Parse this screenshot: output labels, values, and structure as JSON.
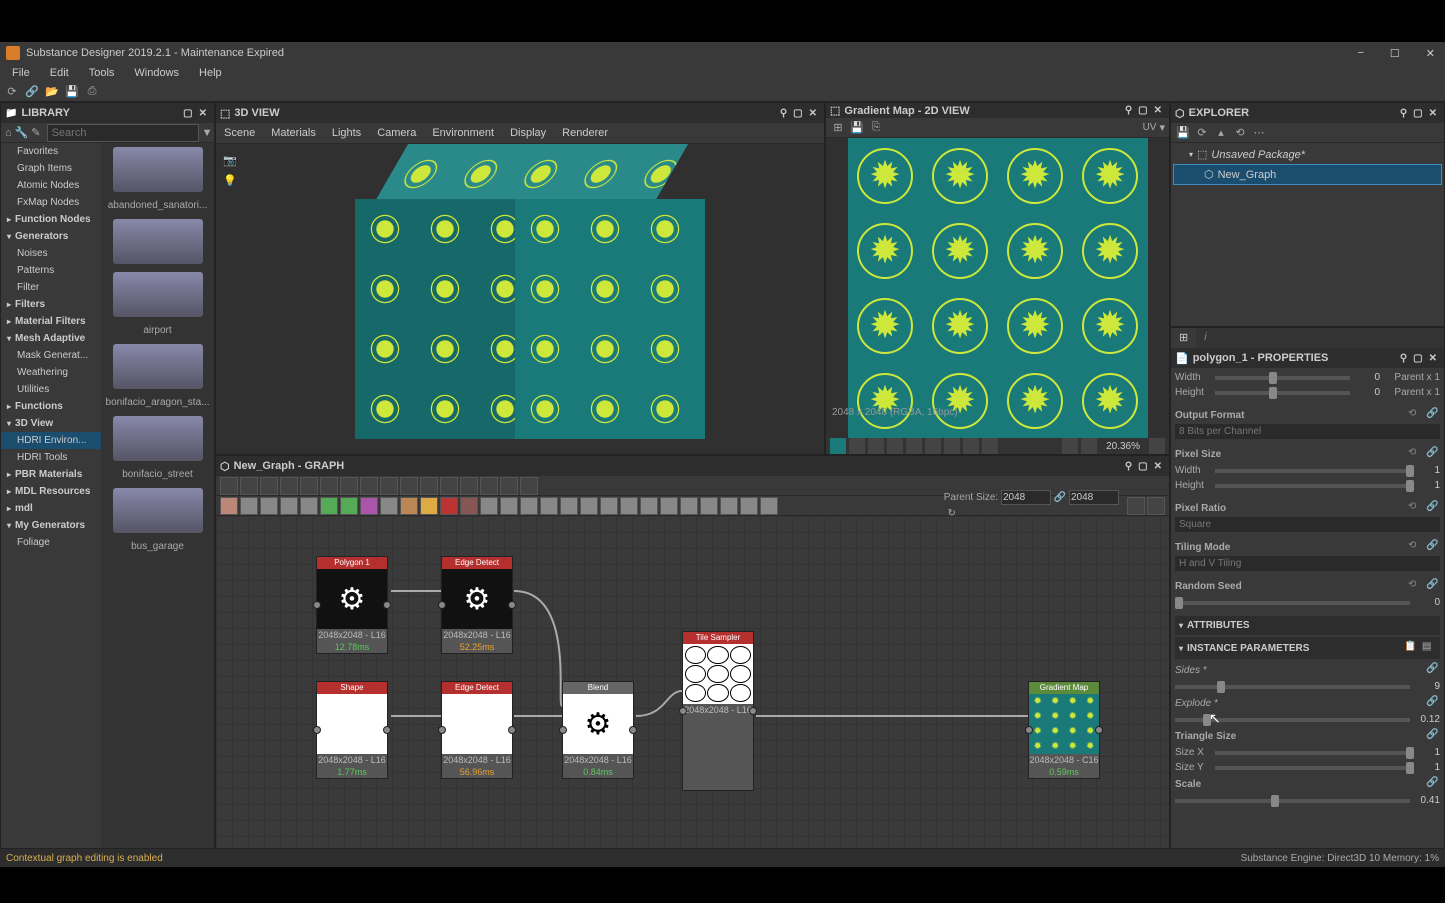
{
  "window": {
    "title": "Substance Designer 2019.2.1 - Maintenance Expired"
  },
  "menubar": [
    "File",
    "Edit",
    "Tools",
    "Windows",
    "Help"
  ],
  "library": {
    "title": "LIBRARY",
    "search_placeholder": "Search",
    "tree": [
      {
        "label": "Favorites",
        "type": "item"
      },
      {
        "label": "Graph Items",
        "type": "item"
      },
      {
        "label": "Atomic Nodes",
        "type": "item"
      },
      {
        "label": "FxMap Nodes",
        "type": "item"
      },
      {
        "label": "Function Nodes",
        "type": "parent"
      },
      {
        "label": "Generators",
        "type": "parent expanded"
      },
      {
        "label": "Noises",
        "type": "item"
      },
      {
        "label": "Patterns",
        "type": "item"
      },
      {
        "label": "Filter",
        "type": "item"
      },
      {
        "label": "Filters",
        "type": "parent"
      },
      {
        "label": "Material Filters",
        "type": "parent"
      },
      {
        "label": "Mesh Adaptive",
        "type": "parent expanded"
      },
      {
        "label": "Mask Generat...",
        "type": "item"
      },
      {
        "label": "Weathering",
        "type": "item"
      },
      {
        "label": "Utilities",
        "type": "item"
      },
      {
        "label": "Functions",
        "type": "parent"
      },
      {
        "label": "3D View",
        "type": "parent expanded"
      },
      {
        "label": "HDRI Environ...",
        "type": "item selected"
      },
      {
        "label": "HDRI Tools",
        "type": "item"
      },
      {
        "label": "PBR Materials",
        "type": "parent"
      },
      {
        "label": "MDL Resources",
        "type": "parent"
      },
      {
        "label": "mdl",
        "type": "parent"
      },
      {
        "label": "My Generators",
        "type": "parent expanded"
      },
      {
        "label": "Foliage",
        "type": "item"
      }
    ],
    "thumbs": [
      "abandoned_sanatori...",
      "",
      "airport",
      "bonifacio_aragon_sta...",
      "bonifacio_street",
      "bus_garage"
    ]
  },
  "view3d": {
    "title": "3D VIEW",
    "menu": [
      "Scene",
      "Materials",
      "Lights",
      "Camera",
      "Environment",
      "Display",
      "Renderer"
    ]
  },
  "view2d": {
    "title": "Gradient Map - 2D VIEW",
    "uv_label": "UV",
    "info": "2048 x 2048 (RGBA, 16bpc)",
    "zoom": "20.36%"
  },
  "graph": {
    "title": "New_Graph - GRAPH",
    "parent_size_label": "Parent Size:",
    "parent_size_value": "2048",
    "nodes": [
      {
        "name": "Polygon 1",
        "header": "red",
        "meta": "2048x2048 - L16",
        "timing": "12.78ms",
        "timing_class": "timing-green",
        "body": "gear-dark"
      },
      {
        "name": "Edge Detect",
        "header": "red",
        "meta": "2048x2048 - L16",
        "timing": "52.25ms",
        "timing_class": "timing-orange",
        "body": "gear-dark"
      },
      {
        "name": "Shape",
        "header": "red",
        "meta": "2048x2048 - L16",
        "timing": "1.77ms",
        "timing_class": "timing-green",
        "body": "circle-white"
      },
      {
        "name": "Edge Detect",
        "header": "red",
        "meta": "2048x2048 - L16",
        "timing": "56.96ms",
        "timing_class": "timing-orange",
        "body": "circle-white"
      },
      {
        "name": "Blend",
        "header": "gray",
        "meta": "2048x2048 - L16",
        "timing": "0.84ms",
        "timing_class": "timing-green",
        "body": "gear-white"
      },
      {
        "name": "Tile Sampler",
        "header": "red",
        "meta": "2048x2048 - L16",
        "timing": "",
        "timing_class": "",
        "body": "grid"
      },
      {
        "name": "Gradient Map",
        "header": "green",
        "meta": "2048x2048 - C16",
        "timing": "0.59ms",
        "timing_class": "timing-green",
        "body": "gmap"
      }
    ]
  },
  "explorer": {
    "title": "EXPLORER",
    "package": "Unsaved Package*",
    "graph": "New_Graph"
  },
  "properties": {
    "title": "polygon_1 - PROPERTIES",
    "base": {
      "width_label": "Width",
      "width_value": "0",
      "width_extra": "Parent x 1",
      "height_label": "Height",
      "height_value": "0",
      "height_extra": "Parent x 1",
      "output_format_label": "Output Format",
      "output_format_value": "8 Bits per Channel",
      "pixel_size_label": "Pixel Size",
      "ps_width_label": "Width",
      "ps_width_value": "1",
      "ps_height_label": "Height",
      "ps_height_value": "1",
      "pixel_ratio_label": "Pixel Ratio",
      "pixel_ratio_value": "Square",
      "tiling_mode_label": "Tiling Mode",
      "tiling_mode_value": "H and V Tiling",
      "random_seed_label": "Random Seed",
      "random_seed_value": "0"
    },
    "attributes_label": "ATTRIBUTES",
    "instance_label": "INSTANCE PARAMETERS",
    "instance": {
      "sides_label": "Sides *",
      "sides_value": "9",
      "explode_label": "Explode *",
      "explode_value": "0.12",
      "triangle_size_label": "Triangle Size",
      "size_x_label": "Size X",
      "size_x_value": "1",
      "size_y_label": "Size Y",
      "size_y_value": "1",
      "scale_label": "Scale",
      "scale_value": "0.41"
    }
  },
  "status": {
    "left": "Contextual graph editing is enabled",
    "right": "Substance Engine: Direct3D 10  Memory: 1%"
  }
}
